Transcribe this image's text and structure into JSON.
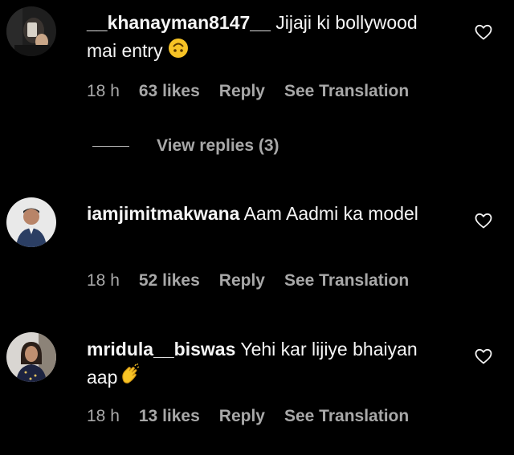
{
  "comments": [
    {
      "username": "__khanayman8147__",
      "text": "Jijaji ki bollywood mai entry",
      "emoji": "upside-down-face-emoji",
      "time": "18 h",
      "likes": "63 likes",
      "reply": "Reply",
      "translate": "See Translation"
    },
    {
      "username": "iamjimitmakwana",
      "text": "Aam Aadmi ka model",
      "time": "18 h",
      "likes": "52 likes",
      "reply": "Reply",
      "translate": "See Translation"
    },
    {
      "username": "mridula__biswas",
      "text": "Yehi kar lijiye bhaiyan aap",
      "emoji": "clapping-hands-emoji",
      "time": "18 h",
      "likes": "13 likes",
      "reply": "Reply",
      "translate": "See Translation"
    }
  ],
  "view_replies": "View replies (3)",
  "colors": {
    "background": "#000000",
    "primary_text": "#f5f5f5",
    "secondary_text": "#a8a8a8",
    "emoji_yellow": "#f7c325"
  }
}
